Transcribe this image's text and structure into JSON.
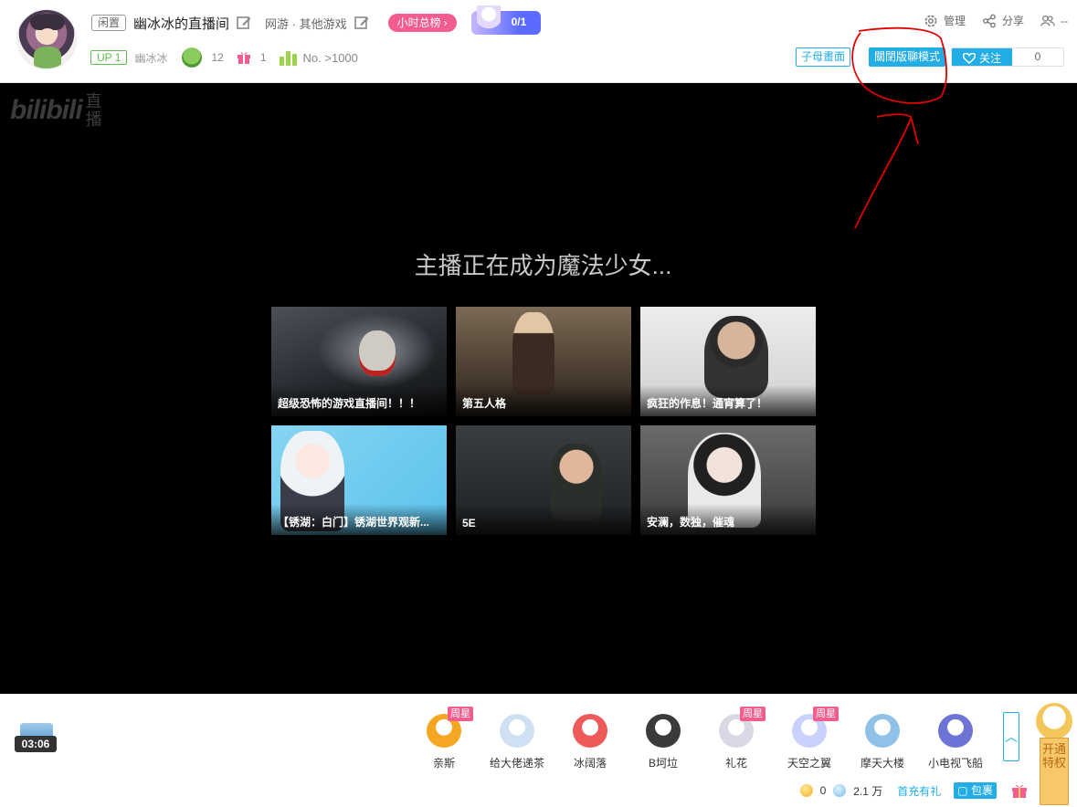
{
  "header": {
    "status_tag": "闲置",
    "room_title": "幽冰冰的直播间",
    "area": "网游 · 其他游戏",
    "rank_button": "小时总榜",
    "badge_count": "0/1",
    "up_level": "UP 1",
    "host_name": "幽冰冰",
    "fans_count": "12",
    "gift_count": "1",
    "rank_text": "No. >1000",
    "actions": {
      "manage": "管理",
      "share": "分享",
      "watching": "--"
    },
    "pip_button": "子母畫面",
    "chat_mode_button": "關閉版聊模式",
    "follow_label": "关注",
    "follow_count": "0"
  },
  "player": {
    "logo_text": "bilibili",
    "logo_sub": "直播",
    "offline_text": "主播正在成为魔法少女...",
    "recommendations": [
      {
        "title": "超级恐怖的游戏直播间！！！"
      },
      {
        "title": "第五人格"
      },
      {
        "title": "疯狂的作息！通宵算了！"
      },
      {
        "title": "【锈湖：白门】锈湖世界观新..."
      },
      {
        "title": "5E"
      },
      {
        "title": "安澜，数独，催魂"
      }
    ]
  },
  "bottom": {
    "treasure_time": "03:06",
    "gifts": [
      {
        "name": "亲斯",
        "badge": "周星",
        "color": "#f5a623",
        "icon": "nice-gift-icon"
      },
      {
        "name": "给大佬递茶",
        "badge": "",
        "color": "#cfe0f3",
        "icon": "tea-gift-icon"
      },
      {
        "name": "冰阔落",
        "badge": "",
        "color": "#ee5a5a",
        "icon": "cola-gift-icon"
      },
      {
        "name": "B坷垃",
        "badge": "",
        "color": "#3b3b3b",
        "icon": "bkela-gift-icon"
      },
      {
        "name": "礼花",
        "badge": "周星",
        "color": "#d9d9e6",
        "icon": "fireworks-gift-icon"
      },
      {
        "name": "天空之翼",
        "badge": "周星",
        "color": "#c9d2ff",
        "icon": "wings-gift-icon"
      },
      {
        "name": "摩天大楼",
        "badge": "",
        "color": "#8fc2e6",
        "icon": "skyscraper-gift-icon"
      },
      {
        "name": "小电视飞船",
        "badge": "",
        "color": "#6d74d6",
        "icon": "tv-ship-gift-icon"
      }
    ],
    "privilege_label": "开通特权",
    "gold_seeds": "0",
    "silver_seeds": "2.1 万",
    "recharge_label": "首充有礼",
    "bag_label": "包裹"
  },
  "colors": {
    "accent": "#23ade5",
    "pink": "#f25d8e",
    "annotation": "#e10000"
  }
}
